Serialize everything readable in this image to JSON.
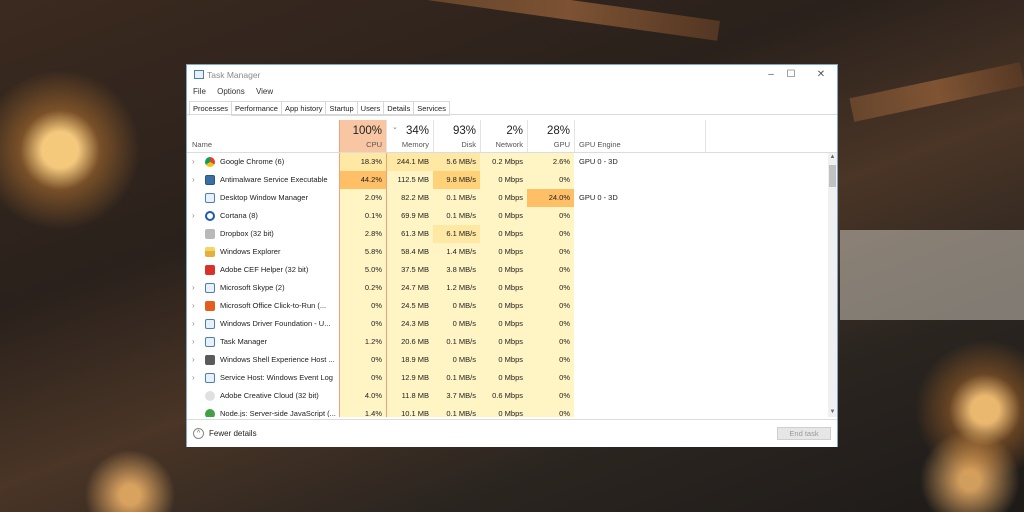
{
  "window": {
    "title": "Task Manager",
    "accent": "#7aa7d6"
  },
  "menu": [
    "File",
    "Options",
    "View"
  ],
  "tabs": [
    "Processes",
    "Performance",
    "App history",
    "Startup",
    "Users",
    "Details",
    "Services"
  ],
  "active_tab": "Processes",
  "columns": {
    "name": "Name",
    "cpu": {
      "pct": "100%",
      "label": "CPU"
    },
    "memory": {
      "pct": "34%",
      "label": "Memory"
    },
    "disk": {
      "pct": "93%",
      "label": "Disk"
    },
    "network": {
      "pct": "2%",
      "label": "Network"
    },
    "gpu": {
      "pct": "28%",
      "label": "GPU"
    },
    "gpu_engine": "GPU Engine"
  },
  "heat_colors": {
    "low": "#fff4c4",
    "mid": "#ffe8a3",
    "high": "#ffd27a",
    "hot": "#ffbf66"
  },
  "processes": [
    {
      "name": "Google Chrome (6)",
      "expand": true,
      "icon": "chrome-icon",
      "cpu": "18.3%",
      "mem": "244.1 MB",
      "disk": "5.6 MB/s",
      "net": "0.2 Mbps",
      "gpu": "2.6%",
      "engine": "GPU 0 - 3D",
      "heat": [
        "mid",
        "mid",
        "mid",
        "low",
        "low"
      ]
    },
    {
      "name": "Antimalware Service Executable",
      "expand": true,
      "icon": "defender-icon",
      "cpu": "44.2%",
      "mem": "112.5 MB",
      "disk": "9.8 MB/s",
      "net": "0 Mbps",
      "gpu": "0%",
      "engine": "",
      "heat": [
        "hot",
        "low",
        "high",
        "low",
        "low"
      ]
    },
    {
      "name": "Desktop Window Manager",
      "expand": false,
      "icon": "window-icon",
      "cpu": "2.0%",
      "mem": "82.2 MB",
      "disk": "0.1 MB/s",
      "net": "0 Mbps",
      "gpu": "24.0%",
      "engine": "GPU 0 - 3D",
      "heat": [
        "low",
        "low",
        "low",
        "low",
        "hot"
      ]
    },
    {
      "name": "Cortana (8)",
      "expand": true,
      "icon": "cortana-icon",
      "cpu": "0.1%",
      "mem": "69.9 MB",
      "disk": "0.1 MB/s",
      "net": "0 Mbps",
      "gpu": "0%",
      "engine": "",
      "heat": [
        "low",
        "low",
        "low",
        "low",
        "low"
      ]
    },
    {
      "name": "Dropbox (32 bit)",
      "expand": false,
      "icon": "dropbox-icon",
      "cpu": "2.8%",
      "mem": "61.3 MB",
      "disk": "6.1 MB/s",
      "net": "0 Mbps",
      "gpu": "0%",
      "engine": "",
      "heat": [
        "low",
        "low",
        "mid",
        "low",
        "low"
      ]
    },
    {
      "name": "Windows Explorer",
      "expand": false,
      "icon": "folder-icon",
      "cpu": "5.8%",
      "mem": "58.4 MB",
      "disk": "1.4 MB/s",
      "net": "0 Mbps",
      "gpu": "0%",
      "engine": "",
      "heat": [
        "low",
        "low",
        "low",
        "low",
        "low"
      ]
    },
    {
      "name": "Adobe CEF Helper (32 bit)",
      "expand": false,
      "icon": "adobe-cef-icon",
      "cpu": "5.0%",
      "mem": "37.5 MB",
      "disk": "3.8 MB/s",
      "net": "0 Mbps",
      "gpu": "0%",
      "engine": "",
      "heat": [
        "low",
        "low",
        "low",
        "low",
        "low"
      ]
    },
    {
      "name": "Microsoft Skype (2)",
      "expand": true,
      "icon": "skype-icon",
      "cpu": "0.2%",
      "mem": "24.7 MB",
      "disk": "1.2 MB/s",
      "net": "0 Mbps",
      "gpu": "0%",
      "engine": "",
      "heat": [
        "low",
        "low",
        "low",
        "low",
        "low"
      ]
    },
    {
      "name": "Microsoft Office Click-to-Run (...",
      "expand": true,
      "icon": "office-icon",
      "cpu": "0%",
      "mem": "24.5 MB",
      "disk": "0 MB/s",
      "net": "0 Mbps",
      "gpu": "0%",
      "engine": "",
      "heat": [
        "low",
        "low",
        "low",
        "low",
        "low"
      ]
    },
    {
      "name": "Windows Driver Foundation - U...",
      "expand": true,
      "icon": "driver-icon",
      "cpu": "0%",
      "mem": "24.3 MB",
      "disk": "0 MB/s",
      "net": "0 Mbps",
      "gpu": "0%",
      "engine": "",
      "heat": [
        "low",
        "low",
        "low",
        "low",
        "low"
      ]
    },
    {
      "name": "Task Manager",
      "expand": true,
      "icon": "taskmgr-icon",
      "cpu": "1.2%",
      "mem": "20.6 MB",
      "disk": "0.1 MB/s",
      "net": "0 Mbps",
      "gpu": "0%",
      "engine": "",
      "heat": [
        "low",
        "low",
        "low",
        "low",
        "low"
      ]
    },
    {
      "name": "Windows Shell Experience Host ...",
      "expand": true,
      "icon": "shell-icon",
      "cpu": "0%",
      "mem": "18.9 MB",
      "disk": "0 MB/s",
      "net": "0 Mbps",
      "gpu": "0%",
      "engine": "",
      "heat": [
        "low",
        "low",
        "low",
        "low",
        "low"
      ]
    },
    {
      "name": "Service Host: Windows Event Log",
      "expand": true,
      "icon": "service-icon",
      "cpu": "0%",
      "mem": "12.9 MB",
      "disk": "0.1 MB/s",
      "net": "0 Mbps",
      "gpu": "0%",
      "engine": "",
      "heat": [
        "low",
        "low",
        "low",
        "low",
        "low"
      ]
    },
    {
      "name": "Adobe Creative Cloud (32 bit)",
      "expand": false,
      "icon": "creative-cloud-icon",
      "cpu": "4.0%",
      "mem": "11.8 MB",
      "disk": "3.7 MB/s",
      "net": "0.6 Mbps",
      "gpu": "0%",
      "engine": "",
      "heat": [
        "low",
        "low",
        "low",
        "low",
        "low"
      ]
    },
    {
      "name": "Node.js: Server-side JavaScript (...",
      "expand": false,
      "icon": "node-icon",
      "cpu": "1.4%",
      "mem": "10.1 MB",
      "disk": "0.1 MB/s",
      "net": "0 Mbps",
      "gpu": "0%",
      "engine": "",
      "heat": [
        "low",
        "low",
        "low",
        "low",
        "low"
      ]
    }
  ],
  "footer": {
    "fewer_details": "Fewer details",
    "end_task": "End task"
  }
}
